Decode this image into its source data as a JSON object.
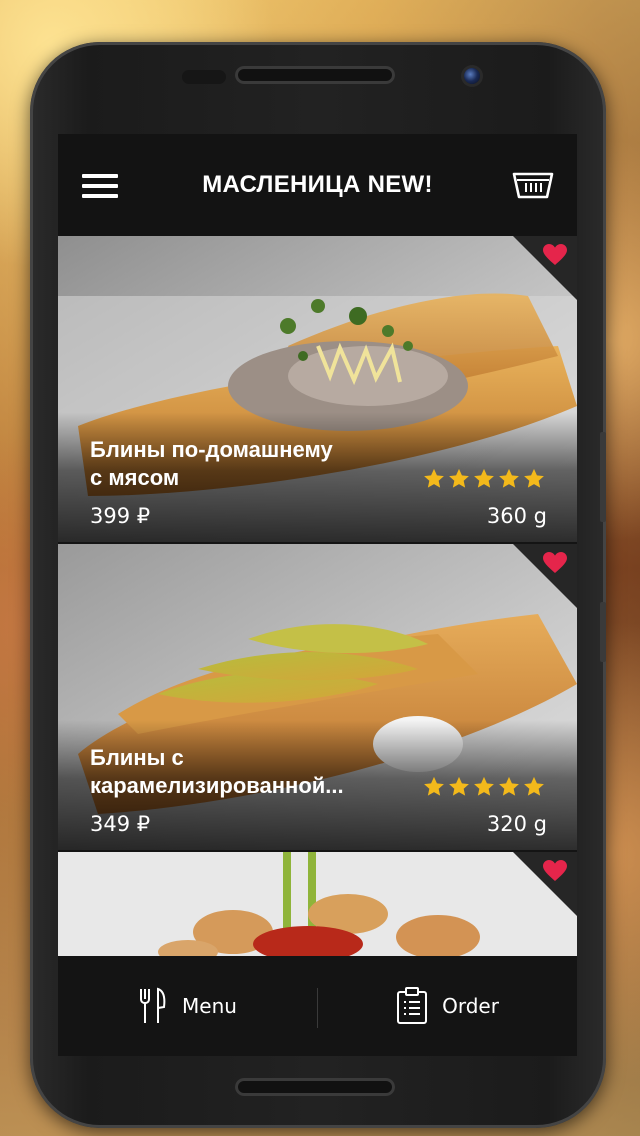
{
  "header": {
    "title": "МАСЛЕНИЦА NEW!",
    "menu_icon": "hamburger-icon",
    "cart_icon": "basket-icon"
  },
  "dishes": [
    {
      "name_line1": "Блины по-домашнему",
      "name_line2": "с мясом",
      "price": "399 ₽",
      "weight": "360 g",
      "rating": 5,
      "favorite": true
    },
    {
      "name_line1": "Блины с",
      "name_line2": "карамелизированной...",
      "price": "349 ₽",
      "weight": "320 g",
      "rating": 5,
      "favorite": true
    },
    {
      "favorite": true
    }
  ],
  "bottom_nav": {
    "menu_label": "Menu",
    "order_label": "Order",
    "menu_icon": "fork-knife-icon",
    "order_icon": "clipboard-list-icon"
  },
  "colors": {
    "accent_heart": "#e5254b",
    "star": "#f3b91b",
    "bar_bg": "#141414"
  }
}
